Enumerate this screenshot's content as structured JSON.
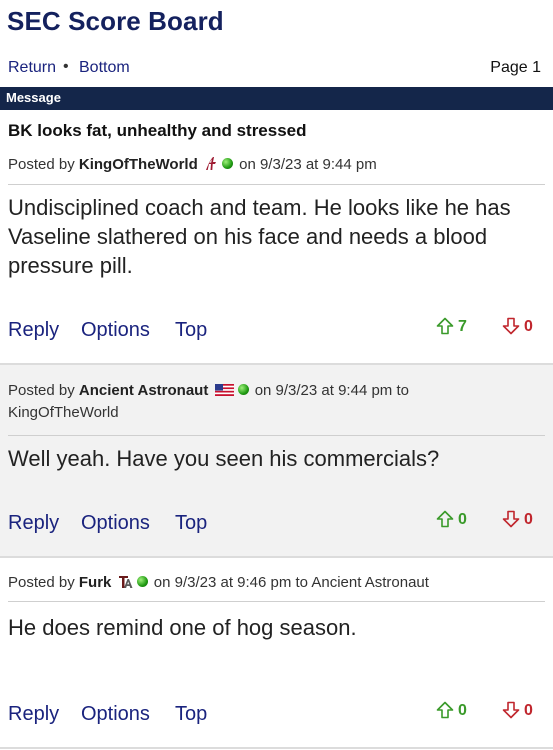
{
  "site": {
    "title": "SEC Score Board"
  },
  "nav": {
    "return": "Return",
    "separator": "•",
    "bottom": "Bottom",
    "page": "Page 1"
  },
  "header_bar": {
    "label": "Message"
  },
  "thread": {
    "title": "BK looks fat, unhealthy and stressed"
  },
  "posts": [
    {
      "posted_by_prefix": "Posted by",
      "user": "KingOfTheWorld",
      "icons": [
        "alabama-script-a-icon",
        "online-status-icon"
      ],
      "timestamp": "on 9/3/23 at 9:44 pm",
      "reply_to": "",
      "body": "Undisciplined coach and team. He looks like he has Vaseline slathered on his face and needs a blood pressure pill.",
      "actions": {
        "reply": "Reply",
        "options": "Options",
        "top": "Top"
      },
      "upvotes": "7",
      "downvotes": "0"
    },
    {
      "posted_by_prefix": "Posted by",
      "user": "Ancient Astronaut",
      "icons": [
        "us-flag-icon",
        "online-status-icon"
      ],
      "timestamp": "on 9/3/23 at 9:44 pm to",
      "reply_to": "KingOfTheWorld",
      "body": "Well yeah. Have you seen his commercials?",
      "actions": {
        "reply": "Reply",
        "options": "Options",
        "top": "Top"
      },
      "upvotes": "0",
      "downvotes": "0"
    },
    {
      "posted_by_prefix": "Posted by",
      "user": "Furk",
      "icons": [
        "texas-am-logo-icon",
        "online-status-icon"
      ],
      "timestamp": "on 9/3/23 at 9:46 pm to Ancient Astronaut",
      "reply_to": "",
      "body": "He does remind one of hog season.",
      "actions": {
        "reply": "Reply",
        "options": "Options",
        "top": "Top"
      },
      "upvotes": "0",
      "downvotes": "0"
    }
  ],
  "colors": {
    "title": "#14215e",
    "link": "#1a237e",
    "bar": "#14264a",
    "upvote": "#3a9a2a",
    "downvote": "#c0262d",
    "alt_post_bg": "#f2f2f2"
  }
}
